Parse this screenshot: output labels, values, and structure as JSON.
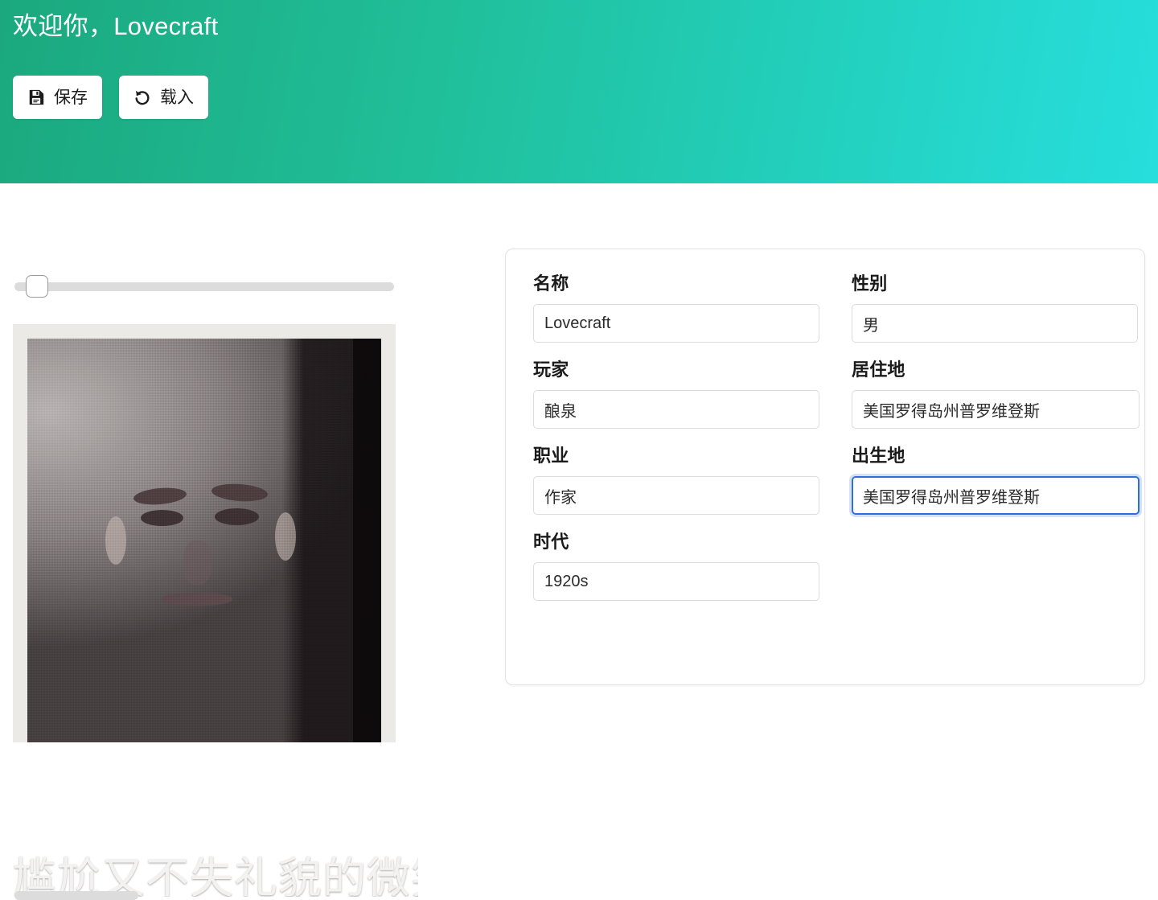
{
  "header": {
    "greeting": "欢迎你，Lovecraft",
    "buttons": [
      {
        "label": "保存",
        "icon": "floppy-disk-icon"
      },
      {
        "label": "载入",
        "icon": "undo-arrow-icon"
      }
    ]
  },
  "left_panel": {
    "slider": {
      "name": "image-zoom-slider",
      "value": 3,
      "min": 0,
      "max": 100
    },
    "portrait": {
      "caption": "尴尬又不失礼貌的微笑",
      "alt_name": "character-portrait"
    }
  },
  "form": {
    "fields": [
      {
        "id": "name",
        "label": "名称",
        "value": "Lovecraft",
        "placeholder": "名称",
        "focused": false,
        "column": "left"
      },
      {
        "id": "gender",
        "label": "性别",
        "value": "男",
        "placeholder": "性别",
        "focused": false,
        "column": "right"
      },
      {
        "id": "player",
        "label": "玩家",
        "value": "酿泉",
        "placeholder": "玩家",
        "focused": false,
        "column": "left"
      },
      {
        "id": "residence",
        "label": "居住地",
        "value": "美国罗得岛州普罗维登斯",
        "placeholder": "居住地",
        "focused": false,
        "column": "right"
      },
      {
        "id": "occupation",
        "label": "职业",
        "value": "作家",
        "placeholder": "职业",
        "focused": false,
        "column": "left"
      },
      {
        "id": "birthplace",
        "label": "出生地",
        "value": "美国罗得岛州普罗维登斯",
        "placeholder": "出生地",
        "focused": true,
        "column": "right"
      },
      {
        "id": "era",
        "label": "时代",
        "value": "1920s",
        "placeholder": "时代",
        "focused": false,
        "column": "left"
      }
    ]
  },
  "colors": {
    "header_gradient_start": "#1ba87e",
    "header_gradient_end": "#27dedd",
    "focus_border": "#2f6fdb",
    "card_border": "#e3e3e3",
    "input_border": "#dcdcdc",
    "slider_track": "#dcdcdc",
    "text_primary": "#1a1a1a",
    "header_text": "#ffffff"
  }
}
